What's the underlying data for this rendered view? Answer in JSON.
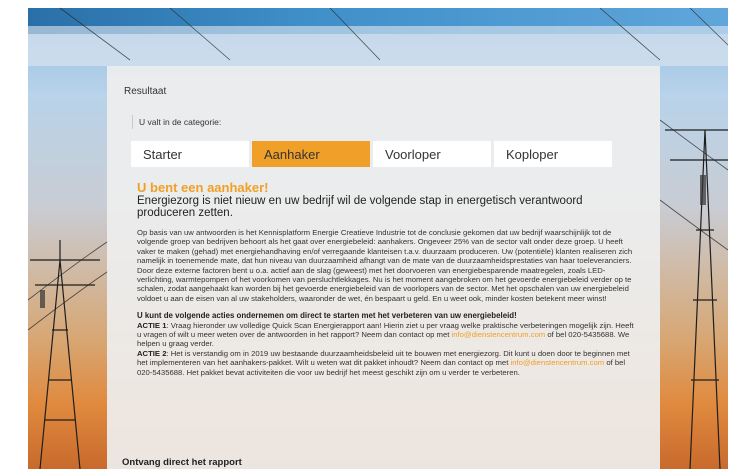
{
  "result": {
    "title": "Resultaat",
    "category_intro": "U valt in de categorie:"
  },
  "tabs": [
    {
      "label": "Starter",
      "active": false
    },
    {
      "label": "Aanhaker",
      "active": true
    },
    {
      "label": "Voorloper",
      "active": false
    },
    {
      "label": "Koploper",
      "active": false
    }
  ],
  "content": {
    "headline": "U bent een aanhaker!",
    "subhead": "Energiezorg is niet nieuw en uw bedrijf wil de volgende stap in energetisch verantwoord produceren zetten.",
    "body": "Op basis van uw antwoorden is het Kennisplatform Energie Creatieve Industrie tot de conclusie gekomen dat uw bedrijf waarschijnlijk tot de volgende groep van bedrijven behoort als het gaat over energiebeleid: aanhakers. Ongeveer 25% van de sector valt onder deze groep. U heeft vaker te maken (gehad) met energiehandhaving en/of verregaande klanteisen t.a.v. duurzaam produceren. Uw (potentiële) klanten realiseren zich namelijk in toenemende mate, dat hun niveau van duurzaamheid afhangt van de mate van de duurzaamheidsprestaties van haar toeleveranciers. Door deze externe factoren bent u o.a. actief aan de slag (geweest) met het doorvoeren van energiebesparende maatregelen, zoals LED-verlichting, warmtepompen of het voorkomen van persluchtlekkages. Nu is het moment aangebroken om het gevoerde energiebeleid verder op te schalen, zodat aangehaakt kan worden bij het gevoerde energiebeleid van de voorlopers van de sector. Met het opschalen van uw energiebeleid voldoet u aan de eisen van al uw stakeholders, waaronder de wet, én bespaart u geld. En u weet ook, minder kosten betekent meer winst!",
    "actions_head": "U kunt de volgende acties ondernemen om direct te starten met het verbeteren van uw energiebeleid!",
    "action1_label": "ACTIE 1",
    "action1_text": ": Vraag hieronder uw volledige Quick Scan Energierapport aan! Hierin ziet u per vraag welke praktische verbeteringen mogelijk zijn. Heeft u vragen of wilt u meer weten over de antwoorden in het rapport? Neem dan contact op met ",
    "action1_email": "info@dienstencentrum.com",
    "action1_tail": " of bel 020-5435688. We helpen u graag verder.",
    "action2_label": "ACTIE 2",
    "action2_text": ": Het is verstandig om in 2019 uw bestaande duurzaamheidsbeleid uit te bouwen met energiezorg. Dit kunt u doen door te beginnen met het implementeren van het aanhakers-pakket. Wilt u weten wat dit pakket inhoudt? Neem dan contact op met ",
    "action2_email": "info@dienstencentrum.com",
    "action2_tail": " of bel 020-5435688. Het pakket bevat activiteiten die voor uw bedrijf het meest geschikt zijn om u verder te verbeteren."
  },
  "report": {
    "title": "Ontvang direct het rapport"
  },
  "colors": {
    "accent": "#f0a028",
    "panel": "#eeeeee"
  }
}
